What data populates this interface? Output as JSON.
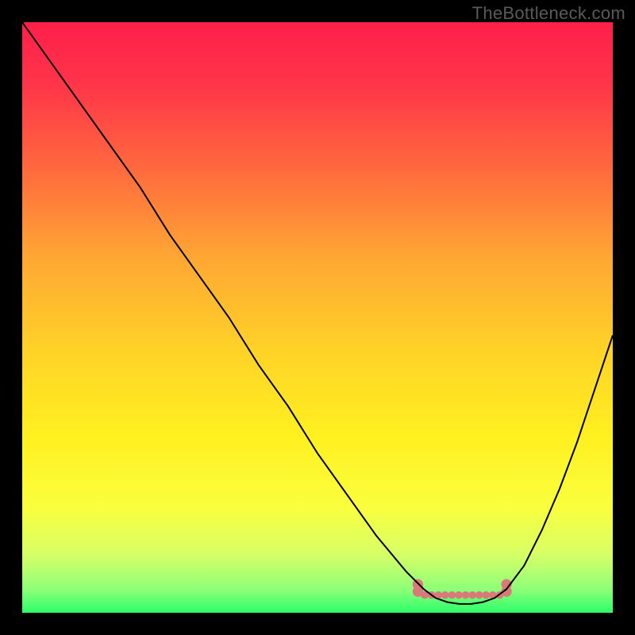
{
  "watermark": "TheBottleneck.com",
  "chart_data": {
    "type": "line",
    "title": "",
    "xlabel": "",
    "ylabel": "",
    "xlim": [
      0,
      100
    ],
    "ylim": [
      0,
      100
    ],
    "grid": false,
    "highlight_range": {
      "x_start": 67,
      "x_end": 82,
      "y": 3,
      "color": "#d87a7a"
    },
    "series": [
      {
        "name": "curve",
        "color": "#000000",
        "x": [
          0,
          5,
          10,
          15,
          20,
          25,
          30,
          35,
          40,
          45,
          50,
          55,
          60,
          65,
          68,
          70,
          72,
          74,
          76,
          78,
          80,
          82,
          85,
          88,
          91,
          94,
          97,
          100
        ],
        "y": [
          100,
          93,
          86,
          79,
          72,
          64,
          57,
          50,
          42,
          35,
          27,
          20,
          13,
          7,
          4,
          2.5,
          1.8,
          1.5,
          1.5,
          1.8,
          2.5,
          4,
          8,
          14,
          21,
          29,
          38,
          47
        ]
      }
    ],
    "gradient_stops": [
      {
        "offset": 0.0,
        "color": "#ff1f4a"
      },
      {
        "offset": 0.1,
        "color": "#ff3349"
      },
      {
        "offset": 0.25,
        "color": "#ff6a3e"
      },
      {
        "offset": 0.4,
        "color": "#ffa733"
      },
      {
        "offset": 0.55,
        "color": "#ffd128"
      },
      {
        "offset": 0.7,
        "color": "#fff020"
      },
      {
        "offset": 0.82,
        "color": "#faff3d"
      },
      {
        "offset": 0.9,
        "color": "#d8ff66"
      },
      {
        "offset": 0.96,
        "color": "#8fff78"
      },
      {
        "offset": 1.0,
        "color": "#2bff6a"
      }
    ]
  }
}
